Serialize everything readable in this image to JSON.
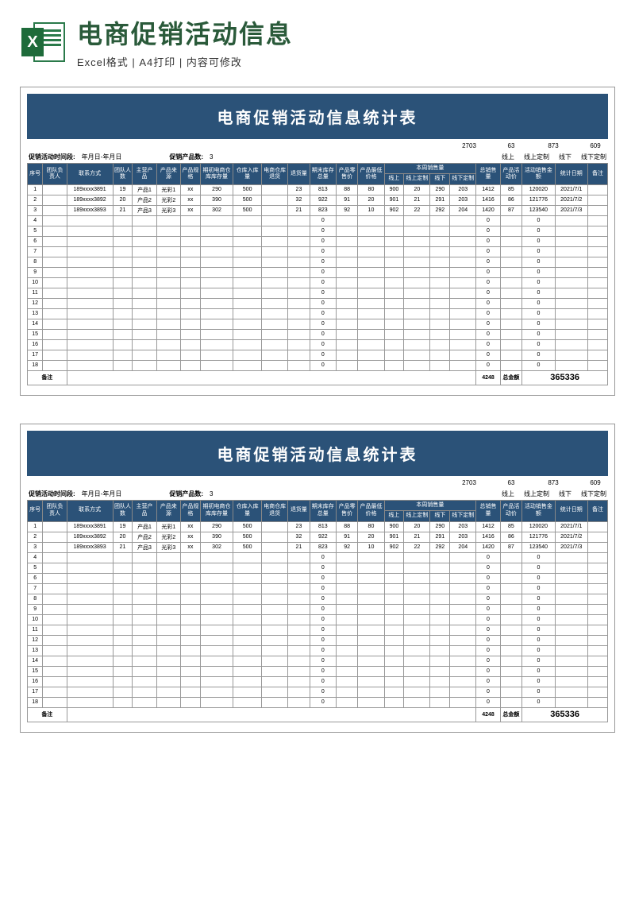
{
  "header": {
    "title": "电商促销活动信息",
    "subtitle": "Excel格式 | A4打印 | 内容可修改"
  },
  "sheet": {
    "banner": "电商促销活动信息统计表",
    "summary": {
      "v1": "2703",
      "v2": "63",
      "v3": "873",
      "v4": "609"
    },
    "summaryLabels": {
      "l1": "线上",
      "l2": "线上定制",
      "l3": "线下",
      "l4": "线下定制"
    },
    "meta": {
      "period_label": "促销活动时间段:",
      "period_value": "年月日-年月日",
      "product_label": "促销产品数:",
      "product_value": "3"
    },
    "columns": [
      "序号",
      "团队负责人",
      "联系方式",
      "团队人数",
      "主营产品",
      "产品来源",
      "产品规格",
      "期初电商仓库库存量",
      "仓库入库量",
      "电商仓库退货",
      "退货量",
      "期末库存总量",
      "产品零售价",
      "产品最低价格",
      "线上",
      "线上定制",
      "线下",
      "线下定制",
      "总销售量",
      "产品活动价",
      "活动销售金额",
      "统计日期",
      "备注"
    ],
    "weekLabel": "本周销售量",
    "rows": [
      {
        "n": "1",
        "contact": "189xxxx3891",
        "team": "19",
        "prod": "产品1",
        "src": "光彩1",
        "spec": "xx",
        "stock0": "290",
        "in": "500",
        "ret": "23",
        "back": "",
        "end": "813",
        "price": "88",
        "low": "80",
        "on": "900",
        "onc": "20",
        "off": "290",
        "offc": "203",
        "total": "1412",
        "ap": "85",
        "amt": "120020",
        "date": "2021/7/1"
      },
      {
        "n": "2",
        "contact": "189xxxx3892",
        "team": "20",
        "prod": "产品2",
        "src": "光彩2",
        "spec": "xx",
        "stock0": "390",
        "in": "500",
        "ret": "32",
        "back": "",
        "end": "922",
        "price": "91",
        "low": "20",
        "on": "901",
        "onc": "21",
        "off": "291",
        "offc": "203",
        "total": "1416",
        "ap": "86",
        "amt": "121776",
        "date": "2021/7/2"
      },
      {
        "n": "3",
        "contact": "189xxxx3893",
        "team": "21",
        "prod": "产品3",
        "src": "光彩3",
        "spec": "xx",
        "stock0": "302",
        "in": "500",
        "ret": "21",
        "back": "",
        "end": "823",
        "price": "92",
        "low": "10",
        "on": "902",
        "onc": "22",
        "off": "292",
        "offc": "204",
        "total": "1420",
        "ap": "87",
        "amt": "123540",
        "date": "2021/7/3"
      }
    ],
    "emptyRows": [
      "4",
      "5",
      "6",
      "7",
      "8",
      "9",
      "10",
      "11",
      "12",
      "13",
      "14",
      "15",
      "16",
      "17",
      "18"
    ],
    "footer": {
      "label": "备注",
      "totalQty": "4248",
      "totalLabel": "总金额",
      "totalAmt": "365336"
    }
  }
}
